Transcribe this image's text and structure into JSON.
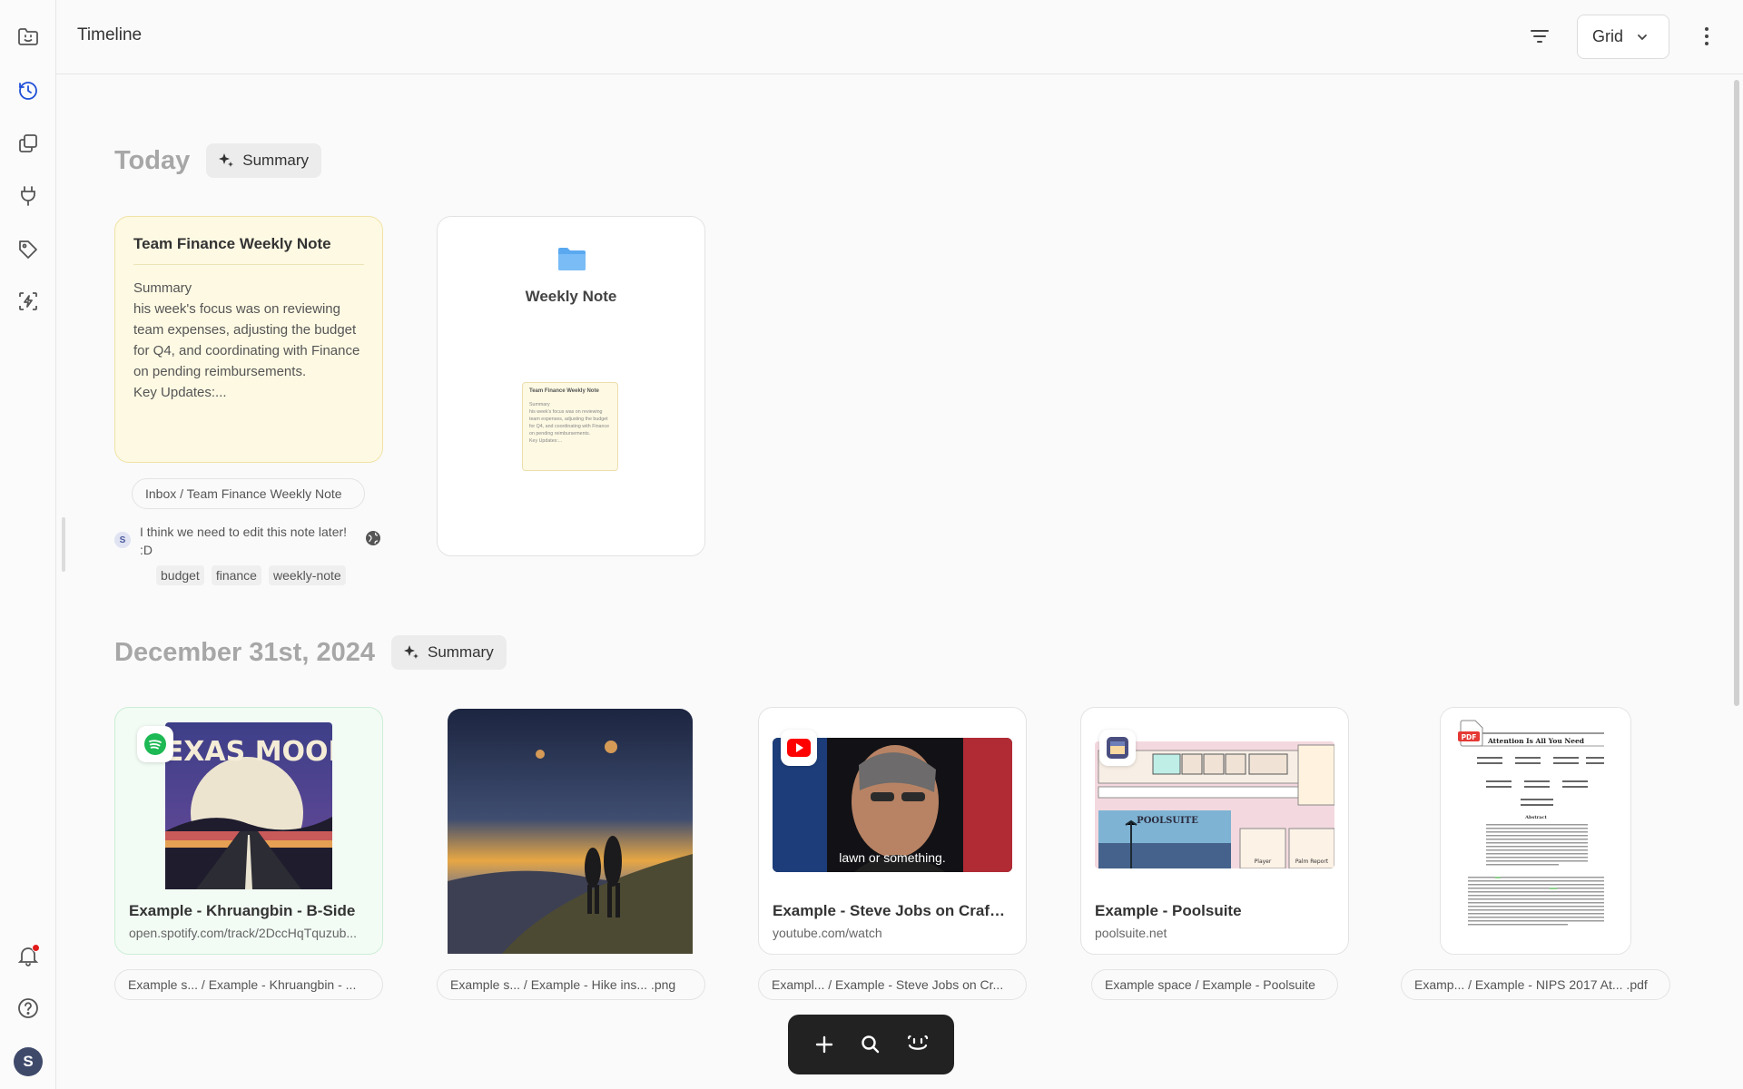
{
  "header": {
    "title": "Timeline",
    "view_mode": "Grid"
  },
  "sidebar": {
    "items": [
      "folder-face-icon",
      "clock-icon",
      "copy-icon",
      "plug-icon",
      "tag-icon",
      "flash-icon"
    ],
    "bottom": [
      "bell-icon",
      "help-icon"
    ],
    "avatar_initial": "S"
  },
  "sections": [
    {
      "title": "Today",
      "summary_label": "Summary"
    },
    {
      "title": "December 31st, 2024",
      "summary_label": "Summary"
    }
  ],
  "note_card": {
    "title": "Team Finance Weekly Note",
    "body": "Summary\nhis week's focus was on reviewing team expenses, adjusting the budget for Q4, and coordinating with Finance on pending reimbursements.\nKey Updates:...",
    "path": "Inbox / Team Finance Weekly Note",
    "comment_author": "S",
    "comment": "I think we need to edit this note later! :D",
    "tags": [
      "budget",
      "finance",
      "weekly-note"
    ]
  },
  "folder_card": {
    "title": "Weekly Note",
    "preview_title": "Team Finance Weekly Note",
    "preview_body": "Summary\nhis week's focus was on reviewing team expenses, adjusting the budget for Q4, and coordinating with Finance on pending reimbursements.\nKey Updates:..."
  },
  "media_cards": [
    {
      "title": "Example - Khruangbin - B-Side",
      "url": "open.spotify.com/track/2DccHqTquzub...",
      "path": "Example s...  / Example - Khruangbin - ...",
      "artwork_text": "TEXAS MOON",
      "source_icon": "spotify-icon"
    },
    {
      "title": "",
      "url": "",
      "path": "Example s...  / Example - Hike ins...  .png",
      "source_icon": "image"
    },
    {
      "title": "Example - Steve Jobs on Craftin...",
      "url": "youtube.com/watch",
      "path": "Exampl...  / Example - Steve Jobs on Cr...",
      "caption": "lawn or something.",
      "source_icon": "youtube-icon"
    },
    {
      "title": "Example - Poolsuite",
      "url": "poolsuite.net",
      "path": "Example space  /  Example - Poolsuite",
      "logo_text": "POOLSUITE",
      "player_label": "Player",
      "report_label": "Palm Report",
      "source_icon": "poolsuite-icon"
    },
    {
      "title": "",
      "url": "",
      "path": "Examp...  / Example - NIPS 2017 At...  .pdf",
      "pdf_title": "Attention Is All You Need",
      "abstract_label": "Abstract",
      "source_icon": "pdf-icon"
    }
  ],
  "toolbar": {
    "items": [
      "add-icon",
      "search-icon",
      "face-icon"
    ]
  }
}
